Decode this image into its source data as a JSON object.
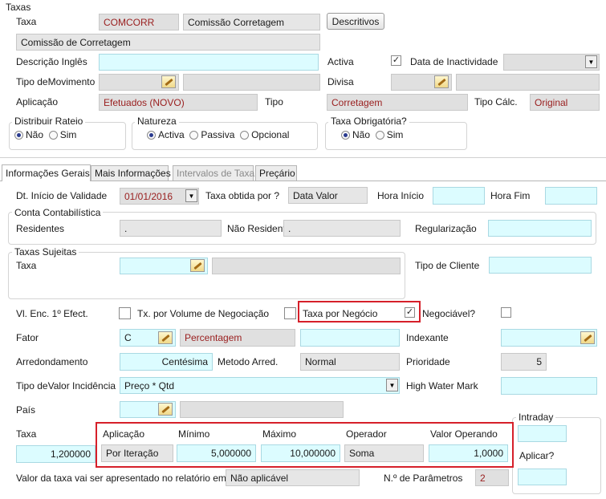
{
  "header": {
    "section_title": "Taxas",
    "taxa_label": "Taxa",
    "taxa_code": "COMCORR",
    "taxa_name": "Comissão Corretagem",
    "descritivos_button": "Descritivos",
    "description": "Comissão de Corretagem",
    "descricao_ingles_label": "Descrição Inglês",
    "descricao_ingles_value": "",
    "activa_label": "Activa",
    "activa_checked": true,
    "data_inactividade_label": "Data de Inactividade",
    "data_inactividade_value": "",
    "tipo_movimento_label": "Tipo deMovimento",
    "divisa_label": "Divisa",
    "aplicacao_label": "Aplicação",
    "aplicacao_value": "Efetuados (NOVO)",
    "tipo_label": "Tipo",
    "tipo_value": "Corretagem",
    "tipo_calc_label": "Tipo Cálc.",
    "tipo_calc_value": "Original"
  },
  "radio_groups": {
    "distribuir_rateio": {
      "label": "Distribuir Rateio",
      "options": [
        "Não",
        "Sim"
      ],
      "selected": "Não"
    },
    "natureza": {
      "label": "Natureza",
      "options": [
        "Activa",
        "Passiva",
        "Opcional"
      ],
      "selected": "Activa"
    },
    "taxa_obrigatoria": {
      "label": "Taxa Obrigatória?",
      "options": [
        "Não",
        "Sim"
      ],
      "selected": "Não"
    }
  },
  "tabs": [
    {
      "label": "Informações Gerais",
      "state": "active"
    },
    {
      "label": "Mais Informações",
      "state": "normal"
    },
    {
      "label": "Intervalos de Taxa",
      "state": "disabled"
    },
    {
      "label": "Preçário",
      "state": "normal"
    }
  ],
  "general": {
    "dt_inicio_label": "Dt. Início de Validade",
    "dt_inicio_value": "01/01/2016",
    "taxa_obtida_label": "Taxa obtida por ?",
    "taxa_obtida_value": "Data Valor",
    "hora_inicio_label": "Hora Início",
    "hora_fim_label": "Hora Fim",
    "conta_contabilistica_label": "Conta Contabilística",
    "residentes_label": "Residentes",
    "residentes_value": ".",
    "nao_residentes_label": "Não Residentes",
    "nao_residentes_value": ".",
    "regularizacao_label": "Regularização",
    "taxas_sujeitas_label": "Taxas Sujeitas",
    "taxa_label": "Taxa",
    "tipo_cliente_label": "Tipo de Cliente",
    "vl_enc_label": "Vl. Enc. 1º Efect.",
    "vl_enc_checked": false,
    "tx_volume_label": "Tx. por Volume de Negociação",
    "tx_volume_checked": false,
    "taxa_negocio_label": "Taxa por Negócio",
    "taxa_negocio_checked": true,
    "negociavel_label": "Negociável?",
    "negociavel_checked": false,
    "fator_label": "Fator",
    "fator_code": "C",
    "fator_value": "Percentagem",
    "indexante_label": "Indexante",
    "arredondamento_label": "Arredondamento",
    "arredondamento_value": "Centésima",
    "metodo_arred_label": "Metodo Arred.",
    "metodo_arred_value": "Normal",
    "prioridade_label": "Prioridade",
    "prioridade_value": "5",
    "tipo_valor_label": "Tipo deValor Incidência",
    "tipo_valor_value": "Preço * Qtd",
    "high_water_label": "High Water Mark",
    "pais_label": "País",
    "intraday_label": "Intraday",
    "taxa_row_label": "Taxa",
    "taxa_row_value": "1,200000",
    "aplicar_label": "Aplicar?",
    "valor_taxa_label": "Valor da taxa vai ser apresentado no relatório em:",
    "valor_taxa_value": "Não aplicável",
    "n_parametros_label": "N.º de Parâmetros",
    "n_parametros_value": "2"
  },
  "operand_table": {
    "headers": {
      "aplicacao": "Aplicação",
      "minimo": "Mínimo",
      "maximo": "Máximo",
      "operador": "Operador",
      "valor_operando": "Valor Operando"
    },
    "row": {
      "aplicacao": "Por Iteração",
      "minimo": "5,000000",
      "maximo": "10,000000",
      "operador": "Soma",
      "valor_operando": "1,0000"
    }
  },
  "colors": {
    "field_cyan": "#dcfcff",
    "field_gray": "#e6e6e6",
    "highlight": "#d6202a",
    "readonly_text": "#9a2020"
  }
}
